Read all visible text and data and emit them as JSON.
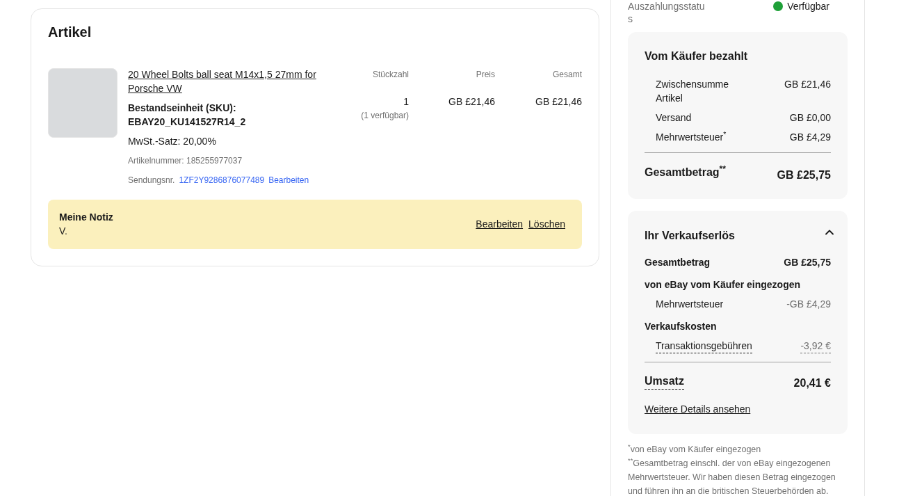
{
  "items_card": {
    "title": "Artikel",
    "columns": [
      "Stückzahl",
      "Preis",
      "Gesamt"
    ],
    "items": [
      {
        "title": "20 Wheel Bolts ball seat M14x1,5 27mm for Porsche VW",
        "sku_label": "Bestandseinheit (SKU):",
        "sku": "EBAY20_KU141527R14_2",
        "vat_rate": "MwSt.-Satz: 20,00%",
        "item_number": "Artikelnummer: 185255977037",
        "tracking_label": "Sendungsnr.",
        "tracking_number": "1ZF2Y9286876077489",
        "tracking_edit": "Bearbeiten",
        "quantity": "1",
        "available": "(1 verfügbar)",
        "price": "GB £21,46",
        "total": "GB £21,46"
      }
    ],
    "note": {
      "title": "Meine Notiz",
      "text": "V.",
      "actions": [
        "Bearbeiten",
        "Löschen"
      ]
    }
  },
  "sidebar": {
    "payout_status": {
      "label": "Auszahlungsstatus",
      "value": "Verfügbar"
    },
    "buyer_paid": {
      "title": "Vom Käufer bezahlt",
      "rows": [
        {
          "label": "Zwischensumme Artikel",
          "value": "GB £21,46"
        },
        {
          "label": "Versand",
          "value": "GB £0,00"
        },
        {
          "label": "Mehrwertsteuer$^{*}$",
          "value": "GB £4,29"
        }
      ],
      "total": {
        "label": "Gesamtbetrag$^{**}$",
        "value": "GB £25,75"
      }
    },
    "proceeds": {
      "title": "Ihr Verkaufserlös",
      "expanded": true,
      "rows": [
        {
          "kind": "group",
          "label": "Gesamtbetrag",
          "value": "GB £25,75"
        },
        {
          "kind": "group",
          "label": "von eBay vom Käufer eingezogen"
        },
        {
          "kind": "detail",
          "label": "Mehrwertsteuer",
          "value": "-GB £4,29"
        },
        {
          "kind": "group",
          "label": "Verkaufskosten"
        },
        {
          "kind": "fee",
          "label": "Transaktionsgebühren",
          "value": "-3,92 €"
        }
      ],
      "total": {
        "label": "Umsatz",
        "value": "20,41 €"
      },
      "link": "Weitere Details ansehen"
    },
    "footnotes": [
      "$^{*}$von eBay vom Käufer eingezogen",
      "$^{**}$Gesamtbetrag einschl. der von eBay eingezogenen Mehrwertsteuer. Wir haben diesen Betrag eingezogen und führen ihn an die britischen Steuerbehörden ab."
    ]
  }
}
